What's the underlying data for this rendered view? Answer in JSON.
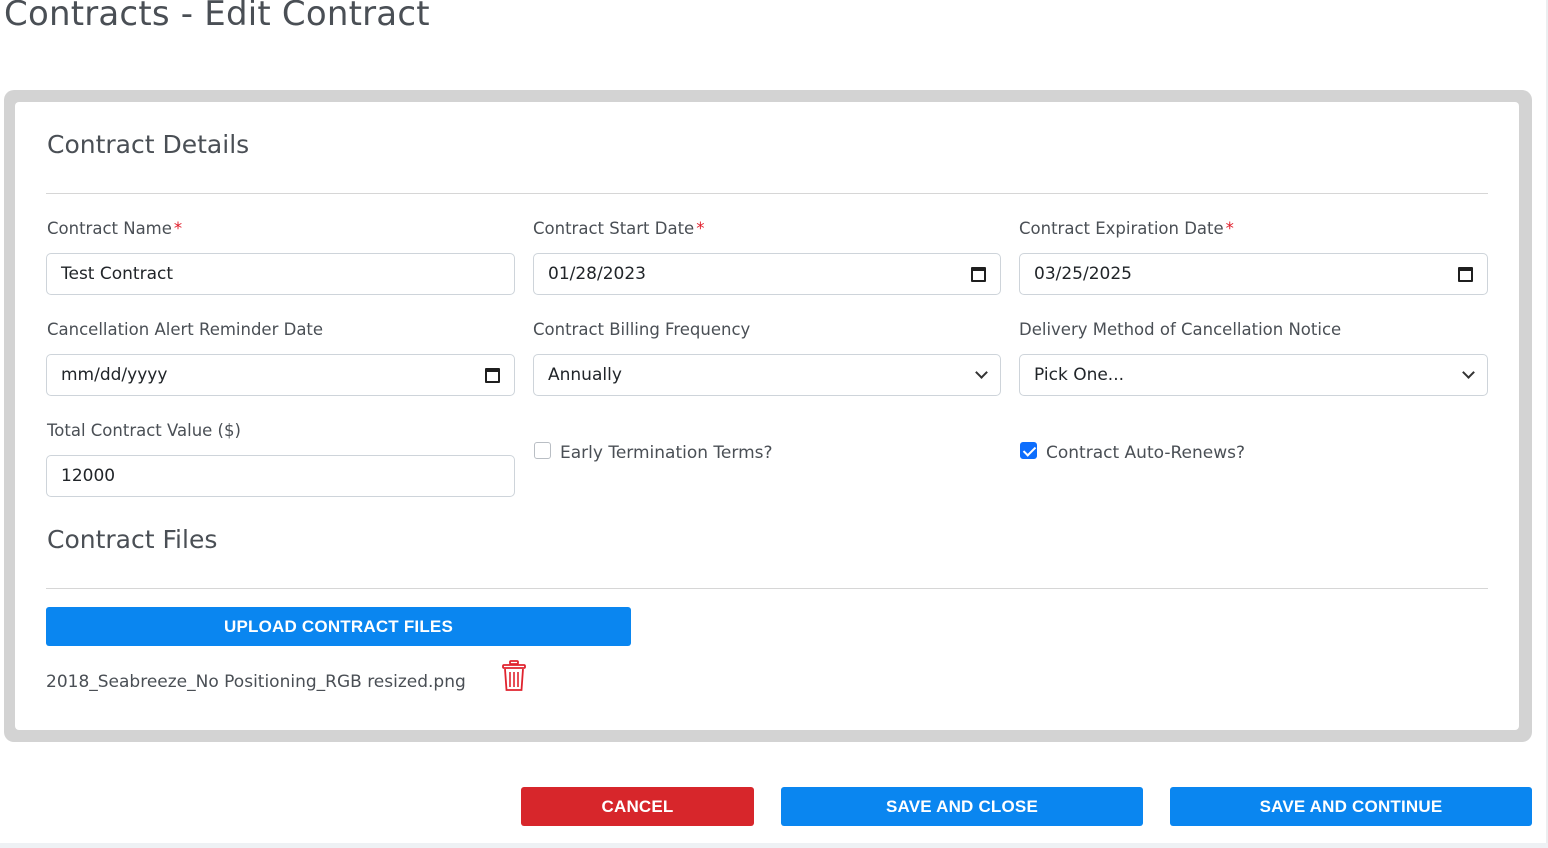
{
  "page": {
    "title": "Contracts - Edit Contract"
  },
  "details": {
    "section_title": "Contract Details",
    "contract_name": {
      "label": "Contract Name",
      "value": "Test Contract"
    },
    "start_date": {
      "label": "Contract Start Date",
      "value": "01/28/2023"
    },
    "expiration_date": {
      "label": "Contract Expiration Date",
      "value": "03/25/2025"
    },
    "cancellation_alert": {
      "label": "Cancellation Alert Reminder Date",
      "value": "mm/dd/yyyy"
    },
    "billing_frequency": {
      "label": "Contract Billing Frequency",
      "value": "Annually"
    },
    "delivery_method": {
      "label": "Delivery Method of Cancellation Notice",
      "value": "Pick One..."
    },
    "total_value": {
      "label": "Total Contract Value ($)",
      "value": "12000"
    },
    "early_termination": {
      "label": "Early Termination Terms?",
      "checked": false
    },
    "auto_renews": {
      "label": "Contract Auto-Renews?",
      "checked": true
    },
    "required_marker": "*"
  },
  "files": {
    "section_title": "Contract Files",
    "upload_label": "UPLOAD CONTRACT FILES",
    "items": [
      {
        "name": "2018_Seabreeze_No Positioning_RGB resized.png"
      }
    ]
  },
  "actions": {
    "cancel_label": "CANCEL",
    "save_close_label": "SAVE AND CLOSE",
    "save_continue_label": "SAVE AND CONTINUE"
  },
  "colors": {
    "primary": "#0a86f0",
    "danger": "#d7262b",
    "required": "#e11d2a",
    "checkbox": "#0d6efd"
  },
  "icons": {
    "date": "calendar-icon",
    "select": "chevron-down-icon",
    "delete": "trash-icon",
    "checked": "checkmark-icon"
  }
}
